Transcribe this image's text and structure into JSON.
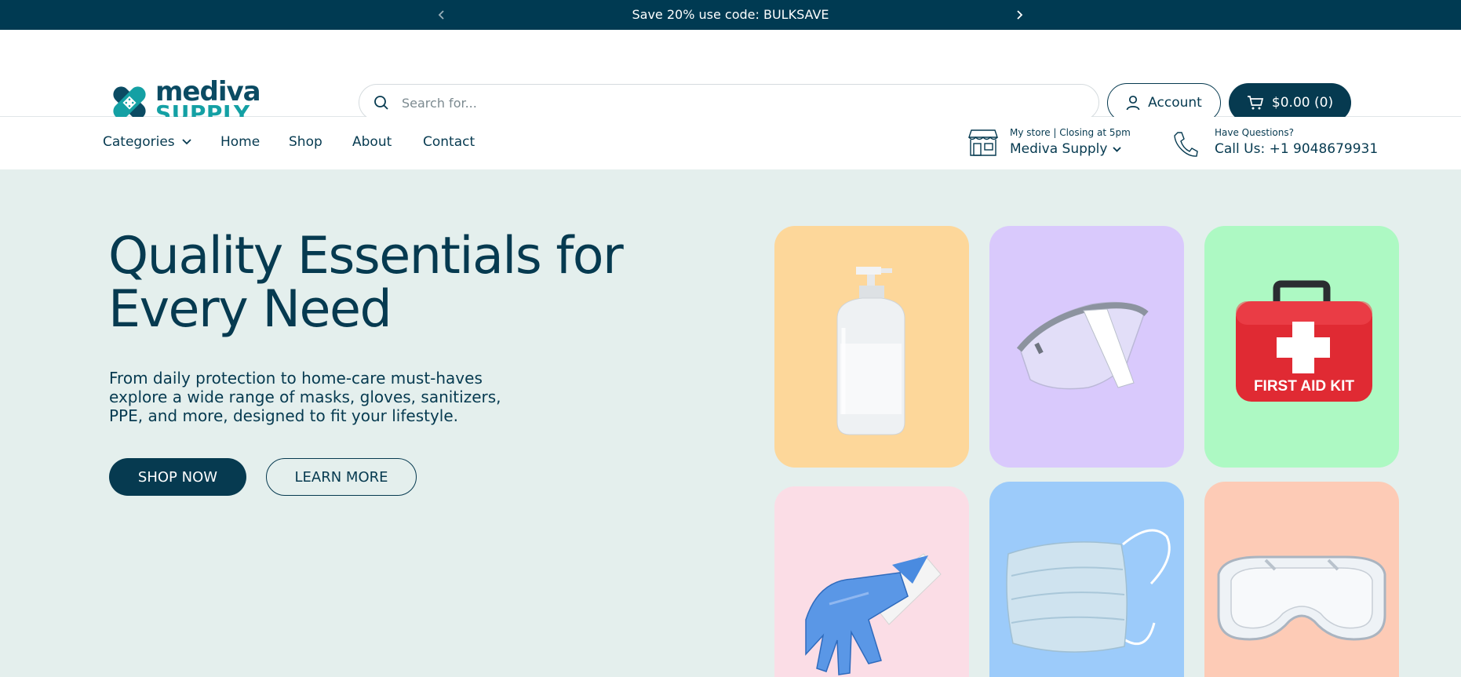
{
  "announcement": {
    "text": "Save 20% use code: BULKSAVE",
    "bar_color": "#003a52"
  },
  "header": {
    "logo": {
      "line1": "mediva",
      "line2": "SUPPLY"
    },
    "search_placeholder": "Search for...",
    "account_label": "Account",
    "cart_label": "$0.00 (0)"
  },
  "nav": {
    "items": [
      {
        "label": "Categories",
        "dropdown": true
      },
      {
        "label": "Home"
      },
      {
        "label": "Shop"
      },
      {
        "label": "About"
      },
      {
        "label": "Contact"
      }
    ]
  },
  "store": {
    "caption": "My store  |  Closing at 5pm",
    "name": "Mediva Supply"
  },
  "contact": {
    "caption": "Have Questions?",
    "phone": "Call Us: +1 9048679931"
  },
  "hero": {
    "title": "Quality Essentials for Every Need",
    "description": "From daily protection to home-care must-haves explore a wide range of masks, gloves, sanitizers, PPE, and more, designed to fit your lifestyle.",
    "shop_button": "SHOP NOW",
    "learn_button": "LEARN MORE"
  },
  "products": {
    "first_aid_label": "FIRST AID KIT",
    "tiles": [
      {
        "item": "sanitizer-bottle",
        "color": "#fdd79a"
      },
      {
        "item": "face-shield",
        "color": "#d9c9fc"
      },
      {
        "item": "first-aid-kit",
        "color": "#adf9c3"
      },
      {
        "item": "gloves",
        "color": "#fbdde6"
      },
      {
        "item": "face-mask",
        "color": "#9ccbfa"
      },
      {
        "item": "safety-goggles",
        "color": "#fdcbb6"
      }
    ]
  },
  "colors": {
    "brand_dark": "#063a50",
    "hero_background": "#e4efed",
    "logo_teal": "#14a0a4"
  }
}
